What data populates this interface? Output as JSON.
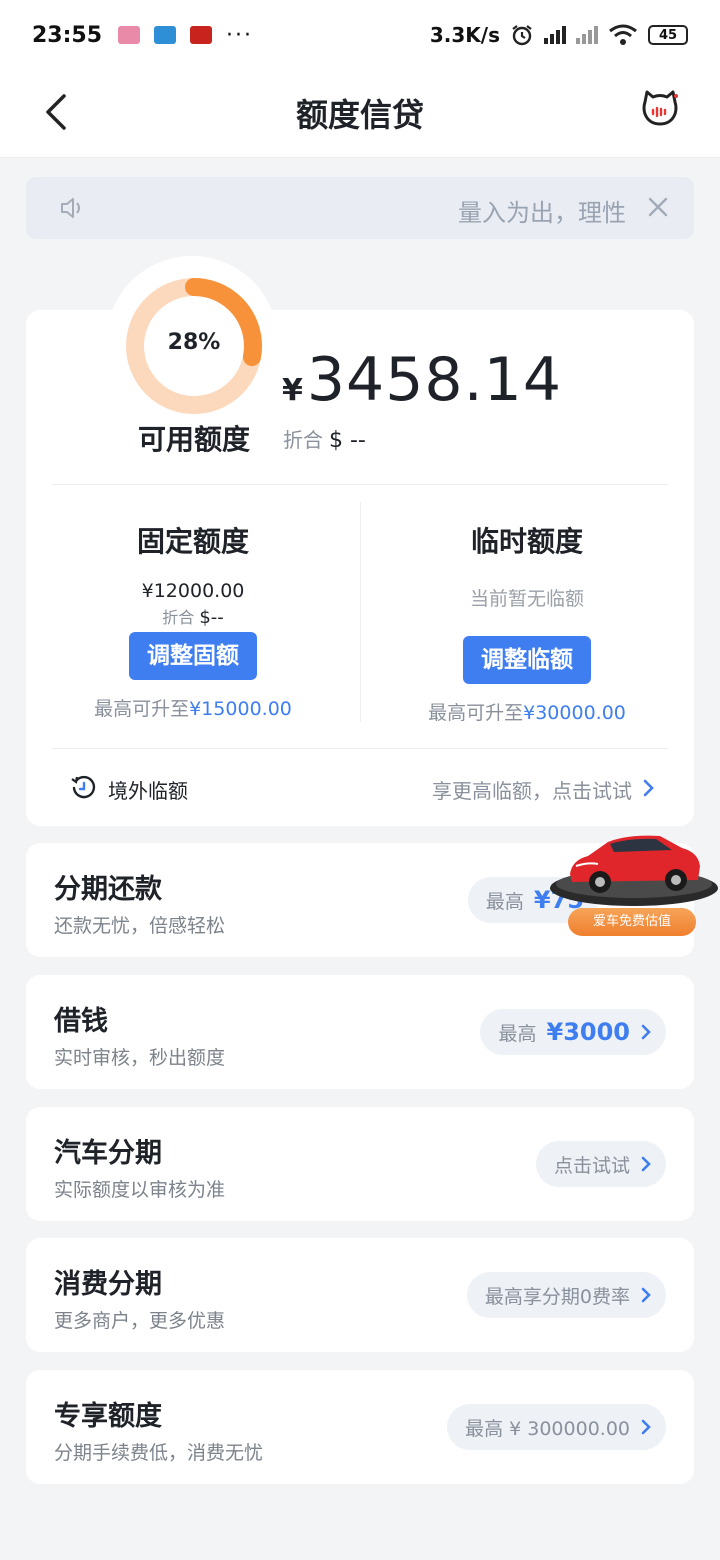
{
  "status_bar": {
    "time": "23:55",
    "dots": "···",
    "speed": "3.3K/s",
    "battery": "45"
  },
  "header": {
    "title": "额度信贷"
  },
  "notice": {
    "text": "量入为出，理性"
  },
  "credit": {
    "usage_percent": "28%",
    "usage_fraction": 0.28,
    "available_label": "可用额度",
    "currency_symbol": "¥",
    "available_amount": "3458.14",
    "usd_label": "折合",
    "usd_value": "$ --"
  },
  "fixed_quota": {
    "title": "固定额度",
    "value": "¥12000.00",
    "usd_label": "折合",
    "usd_value": "$--",
    "button": "调整固额",
    "max_prefix": "最高可升至",
    "max_value": "¥15000.00"
  },
  "temp_quota": {
    "title": "临时额度",
    "value": "当前暂无临额",
    "button": "调整临额",
    "max_prefix": "最高可升至",
    "max_value": "¥30000.00"
  },
  "overseas": {
    "label": "境外临额",
    "link": "享更高临额，点击试试"
  },
  "services": [
    {
      "title": "分期还款",
      "subtitle": "还款无忧，倍感轻松",
      "pill_prefix": "最高",
      "pill_value": "¥75"
    },
    {
      "title": "借钱",
      "subtitle": "实时审核，秒出额度",
      "pill_prefix": "最高",
      "pill_value": "¥3000"
    },
    {
      "title": "汽车分期",
      "subtitle": "实际额度以审核为准",
      "pill_prefix": "",
      "pill_value": "点击试试"
    },
    {
      "title": "消费分期",
      "subtitle": "更多商户，更多优惠",
      "pill_prefix": "",
      "pill_value": "最高享分期0费率"
    },
    {
      "title": "专享额度",
      "subtitle": "分期手续费低，消费无忧",
      "pill_prefix": "",
      "pill_value": "最高 ¥ 300000.00"
    }
  ],
  "car_ad": {
    "label": "爱车免费估值"
  },
  "colors": {
    "accent": "#3f7ef0",
    "ring_fill": "#f7923a",
    "ring_track": "#fcd9bd",
    "background": "#f3f4f6"
  }
}
